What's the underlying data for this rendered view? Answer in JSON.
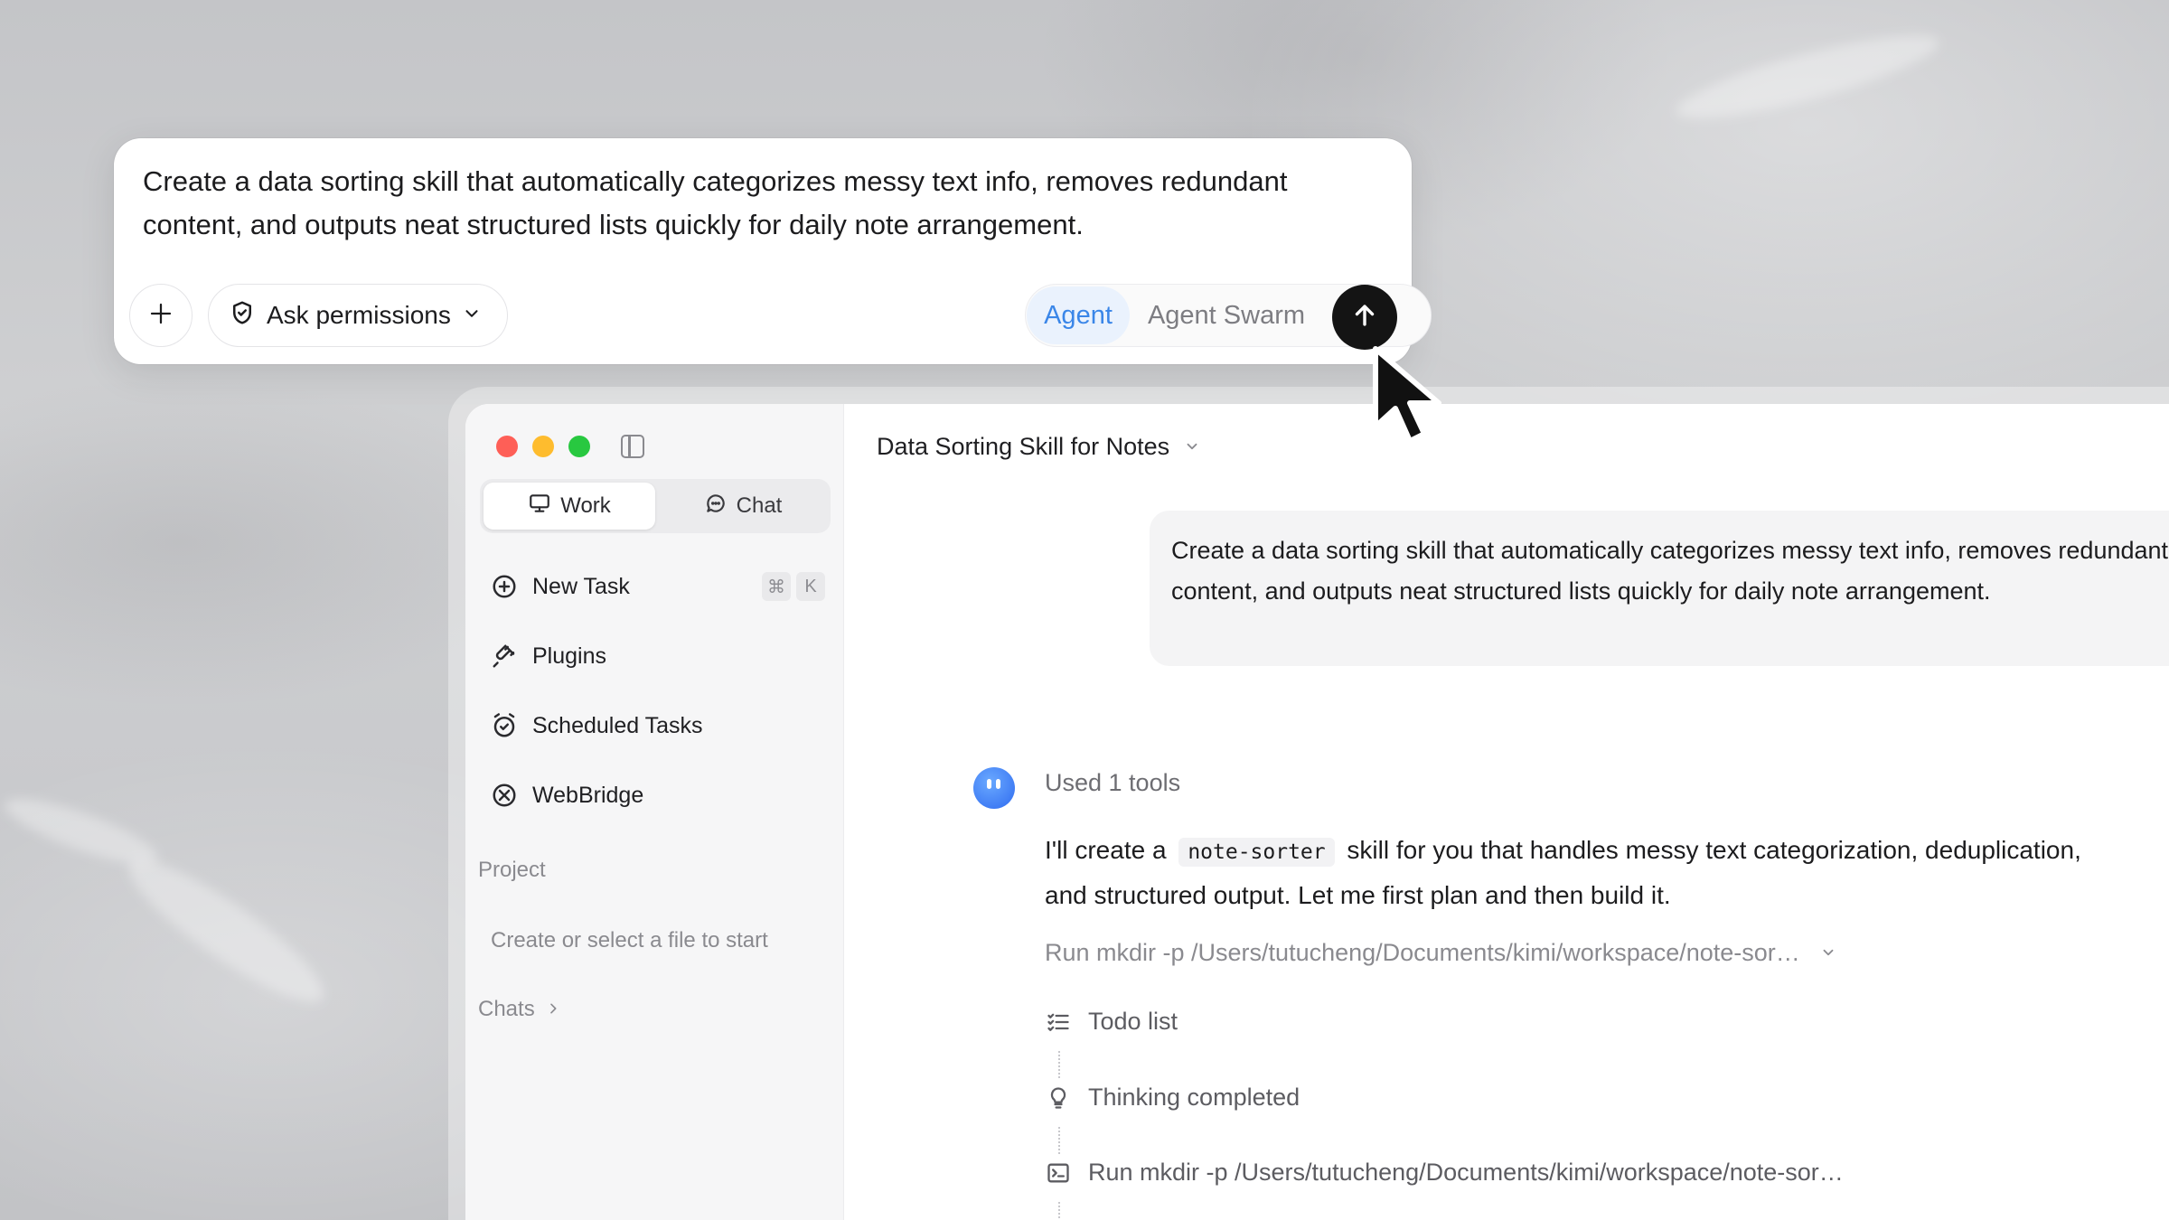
{
  "composer": {
    "prompt_text": "Create a data sorting skill that automatically categorizes messy text info, removes redundant content, and outputs neat structured lists quickly for daily note arrangement.",
    "permissions_label": "Ask permissions",
    "modes": [
      "Agent",
      "Agent Swarm"
    ],
    "selected_mode": "Agent"
  },
  "sidebar": {
    "tabs": {
      "work": "Work",
      "chat": "Chat"
    },
    "nav": {
      "new_task": "New Task",
      "shortcut_cmd": "⌘",
      "shortcut_key": "K",
      "plugins": "Plugins",
      "scheduled_tasks": "Scheduled Tasks",
      "webbridge": "WebBridge"
    },
    "project_label": "Project",
    "project_hint": "Create or select a file to start",
    "chats_label": "Chats"
  },
  "main": {
    "task_title": "Data Sorting Skill for Notes",
    "user_message": "Create a data sorting skill that automatically categorizes messy text info, removes redundant content, and outputs neat structured lists quickly for daily note arrangement.",
    "used_tools": "Used 1 tools",
    "reply_prefix": "I'll create a",
    "reply_code": "note-sorter",
    "reply_suffix": "skill for you that handles messy text categorization, deduplication, and structured output. Let me first plan and then build it.",
    "run_summary": "Run mkdir -p /Users/tutucheng/Documents/kimi/workspace/note-sor…",
    "steps": {
      "todo": "Todo list",
      "thinking": "Thinking completed",
      "run": "Run mkdir -p /Users/tutucheng/Documents/kimi/workspace/note-sor…"
    }
  },
  "colors": {
    "accent": "#3a86e8",
    "send_button": "#141414",
    "close": "#fe5f57",
    "minimize": "#febc2e",
    "maximize": "#28c840"
  },
  "icons": {
    "add": "plus-icon",
    "permissions": "shield-check-icon",
    "send": "arrow-up-icon",
    "cursor": "mouse-pointer-icon"
  }
}
